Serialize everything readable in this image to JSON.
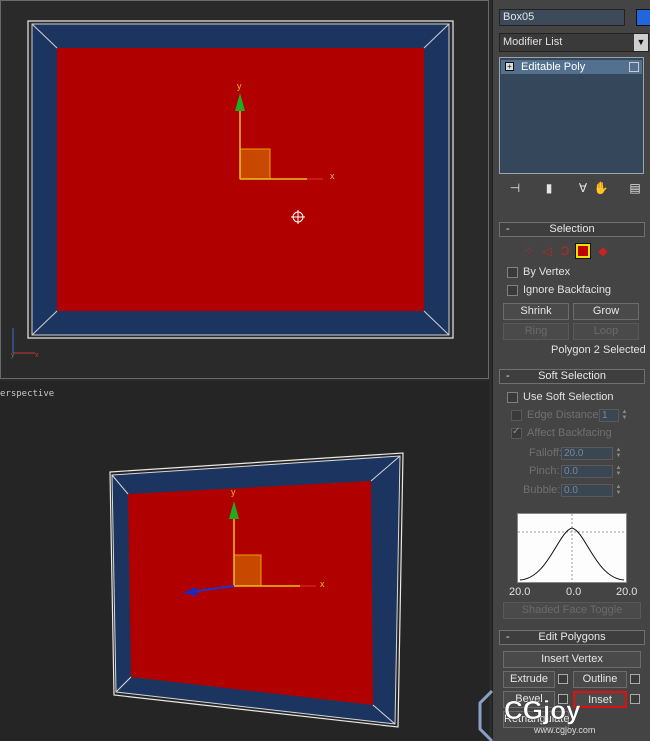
{
  "viewports": {
    "top": {
      "gizmo": {
        "x_label": "x",
        "y_label": "y"
      }
    },
    "perspective": {
      "label": "erspective",
      "gizmo": {
        "x_label": "x",
        "y_label": "y"
      }
    }
  },
  "panel": {
    "object_name": "Box05",
    "object_color": "#2266dd",
    "modifier_list": "Modifier List",
    "stack": {
      "item": "Editable Poly"
    },
    "selection": {
      "title": "Selection",
      "minus": "-",
      "by_vertex": "By Vertex",
      "ignore_backfacing": "Ignore Backfacing",
      "shrink": "Shrink",
      "grow": "Grow",
      "ring": "Ring",
      "loop": "Loop",
      "status": "Polygon 2 Selected",
      "active_mode": "polygon"
    },
    "soft_selection": {
      "title": "Soft Selection",
      "minus": "-",
      "use_soft": "Use Soft Selection",
      "edge_distance": "Edge Distance:",
      "edge_distance_value": "1",
      "affect_backfacing": "Affect Backfacing",
      "falloff": "Falloff:",
      "falloff_value": "20.0",
      "pinch": "Pinch:",
      "pinch_value": "0.0",
      "bubble": "Bubble:",
      "bubble_value": "0.0",
      "curve_left": "20.0",
      "curve_mid": "0.0",
      "curve_right": "20.0",
      "shaded_face_toggle": "Shaded Face Toggle"
    },
    "edit_polygons": {
      "title": "Edit Polygons",
      "minus": "-",
      "insert_vertex": "Insert Vertex",
      "extrude": "Extrude",
      "outline": "Outline",
      "bevel": "Bevel",
      "inset": "Inset",
      "retriangulate": "Retriangulate"
    }
  },
  "watermark": {
    "brand": "CGjoy",
    "url": "www.cgjoy.com"
  },
  "colors": {
    "face_red": "#b00000",
    "frame_blue": "#1b3560",
    "gizmo_yellow": "#e8c020",
    "gizmo_green": "#22aa22"
  }
}
